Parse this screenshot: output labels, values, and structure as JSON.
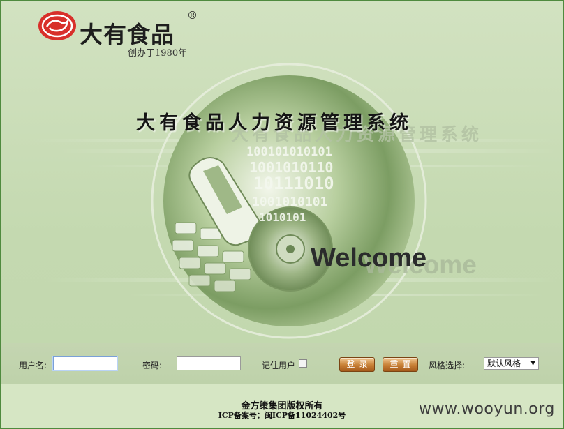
{
  "header": {
    "brand_name": "大有食品",
    "brand_registered": "®",
    "brand_tagline": "创办于1980年"
  },
  "banner": {
    "system_title": "大有食品人力资源管理系统",
    "system_title_shadow": "大有食品人力资源管理系统",
    "welcome": "Welcome",
    "binary_rows": [
      "100101010101",
      "1001010110",
      "10111010",
      "1001010101",
      "1010101"
    ]
  },
  "login": {
    "username_label": "用户名:",
    "username_value": "",
    "password_label": "密码:",
    "password_value": "",
    "remember_label": "记住用户",
    "remember_checked": false,
    "login_button": "登录",
    "reset_button": "重置",
    "style_label": "风格选择:",
    "style_selected": "默认风格",
    "style_arrow": "▼"
  },
  "footer": {
    "copyright": "金方策集团版权所有",
    "icp": "ICP备案号：闽ICP备11024402号"
  },
  "watermark": "www.wooyun.org",
  "colors": {
    "frame_border": "#4f8a3e",
    "background": "#c6d9b2",
    "button_orange": "#c77f35",
    "logo_red": "#d8302a"
  }
}
